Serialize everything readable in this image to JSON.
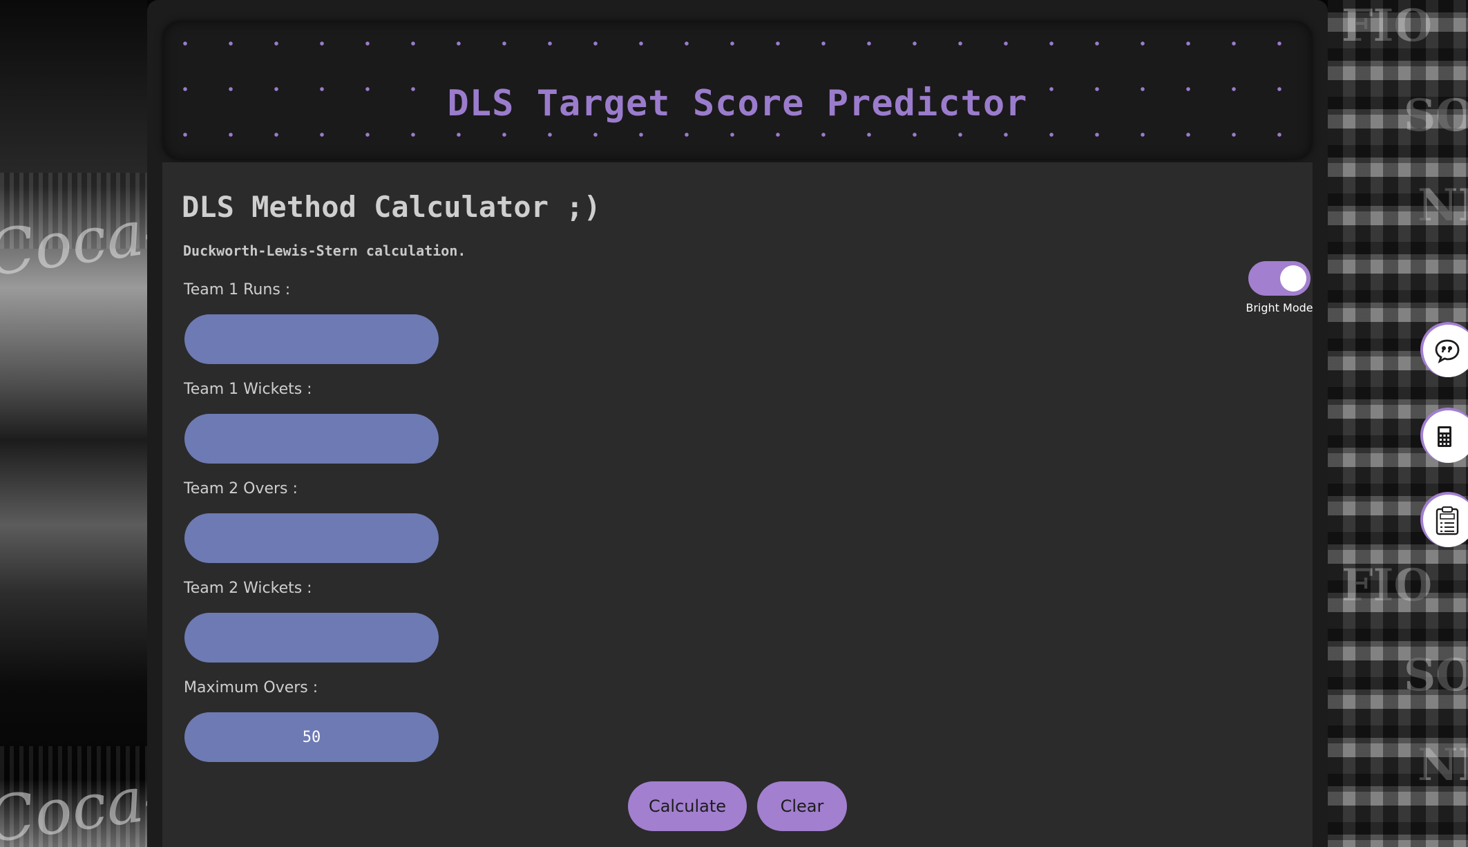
{
  "header": {
    "title": "DLS Target Score Predictor"
  },
  "calculator": {
    "title": "DLS Method Calculator ;)",
    "subtitle": "Duckworth-Lewis-Stern calculation."
  },
  "fields": [
    {
      "label": "Team 1 Runs :",
      "value": ""
    },
    {
      "label": "Team 1 Wickets :",
      "value": ""
    },
    {
      "label": "Team 2 Overs :",
      "value": ""
    },
    {
      "label": "Team 2 Wickets :",
      "value": ""
    },
    {
      "label": "Maximum Overs :",
      "value": "50"
    }
  ],
  "buttons": {
    "calculate": "Calculate",
    "clear": "Clear"
  },
  "theme_toggle": {
    "label": "Bright Mode",
    "on": true
  },
  "side_icons": [
    "quote-chat-icon",
    "calculator-icon",
    "plan-clipboard-icon"
  ],
  "colors": {
    "accent": "#a27fcf",
    "input_bg": "#6e7ab3",
    "panel_bg": "#2b2b2b",
    "header_bg": "#1a1a1a"
  }
}
